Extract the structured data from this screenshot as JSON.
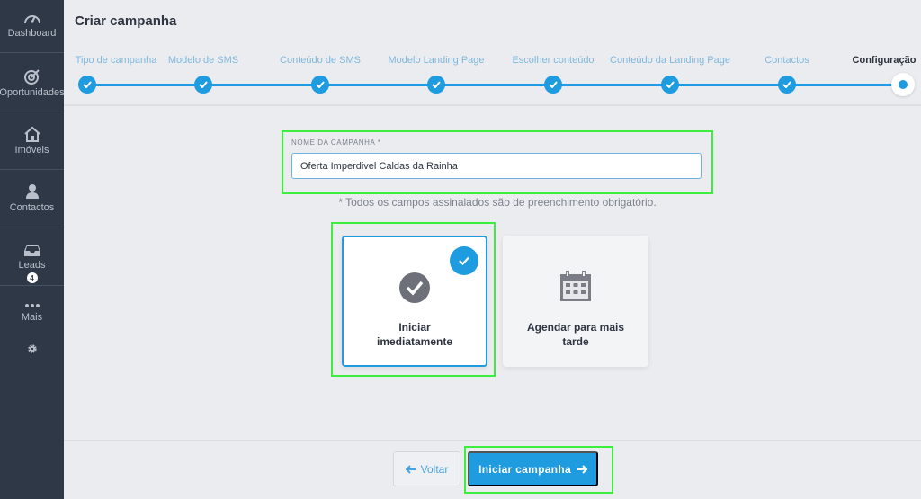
{
  "sidebar": {
    "items": [
      {
        "label": "Dashboard",
        "icon": "gauge-icon"
      },
      {
        "label": "Oportunidades",
        "icon": "target-icon"
      },
      {
        "label": "Imóveis",
        "icon": "house-icon"
      },
      {
        "label": "Contactos",
        "icon": "person-icon"
      },
      {
        "label": "Leads",
        "icon": "inbox-icon",
        "badge": "4"
      },
      {
        "label": "Mais",
        "icon": "ellipsis-icon"
      }
    ],
    "settings_icon": "gear-icon"
  },
  "header": {
    "title": "Criar campanha"
  },
  "stepper": {
    "steps": [
      {
        "label": "Tipo de campanha",
        "state": "done"
      },
      {
        "label": "Modelo de SMS",
        "state": "done"
      },
      {
        "label": "Conteúdo de SMS",
        "state": "done"
      },
      {
        "label": "Modelo Landing Page",
        "state": "done"
      },
      {
        "label": "Escolher conteúdo",
        "state": "done"
      },
      {
        "label": "Conteúdo da Landing Page",
        "state": "done"
      },
      {
        "label": "Contactos",
        "state": "done"
      },
      {
        "label": "Configuração",
        "state": "current"
      }
    ]
  },
  "form": {
    "name_label": "NOME DA CAMPANHA *",
    "name_value": "Oferta Imperdivel Caldas da Rainha",
    "required_note": "* Todos os campos assinalados são de preenchimento obrigatório."
  },
  "options": [
    {
      "label": "Iniciar imediatamente",
      "icon": "check-circle-icon",
      "selected": true
    },
    {
      "label": "Agendar para mais tarde",
      "icon": "calendar-icon",
      "selected": false
    }
  ],
  "footer": {
    "back_label": "Voltar",
    "start_label": "Iniciar campanha"
  },
  "colors": {
    "accent": "#1f9be0",
    "sidebar_bg": "#2f3847",
    "page_bg": "#ebecf0",
    "highlight": "#3cef3c"
  }
}
